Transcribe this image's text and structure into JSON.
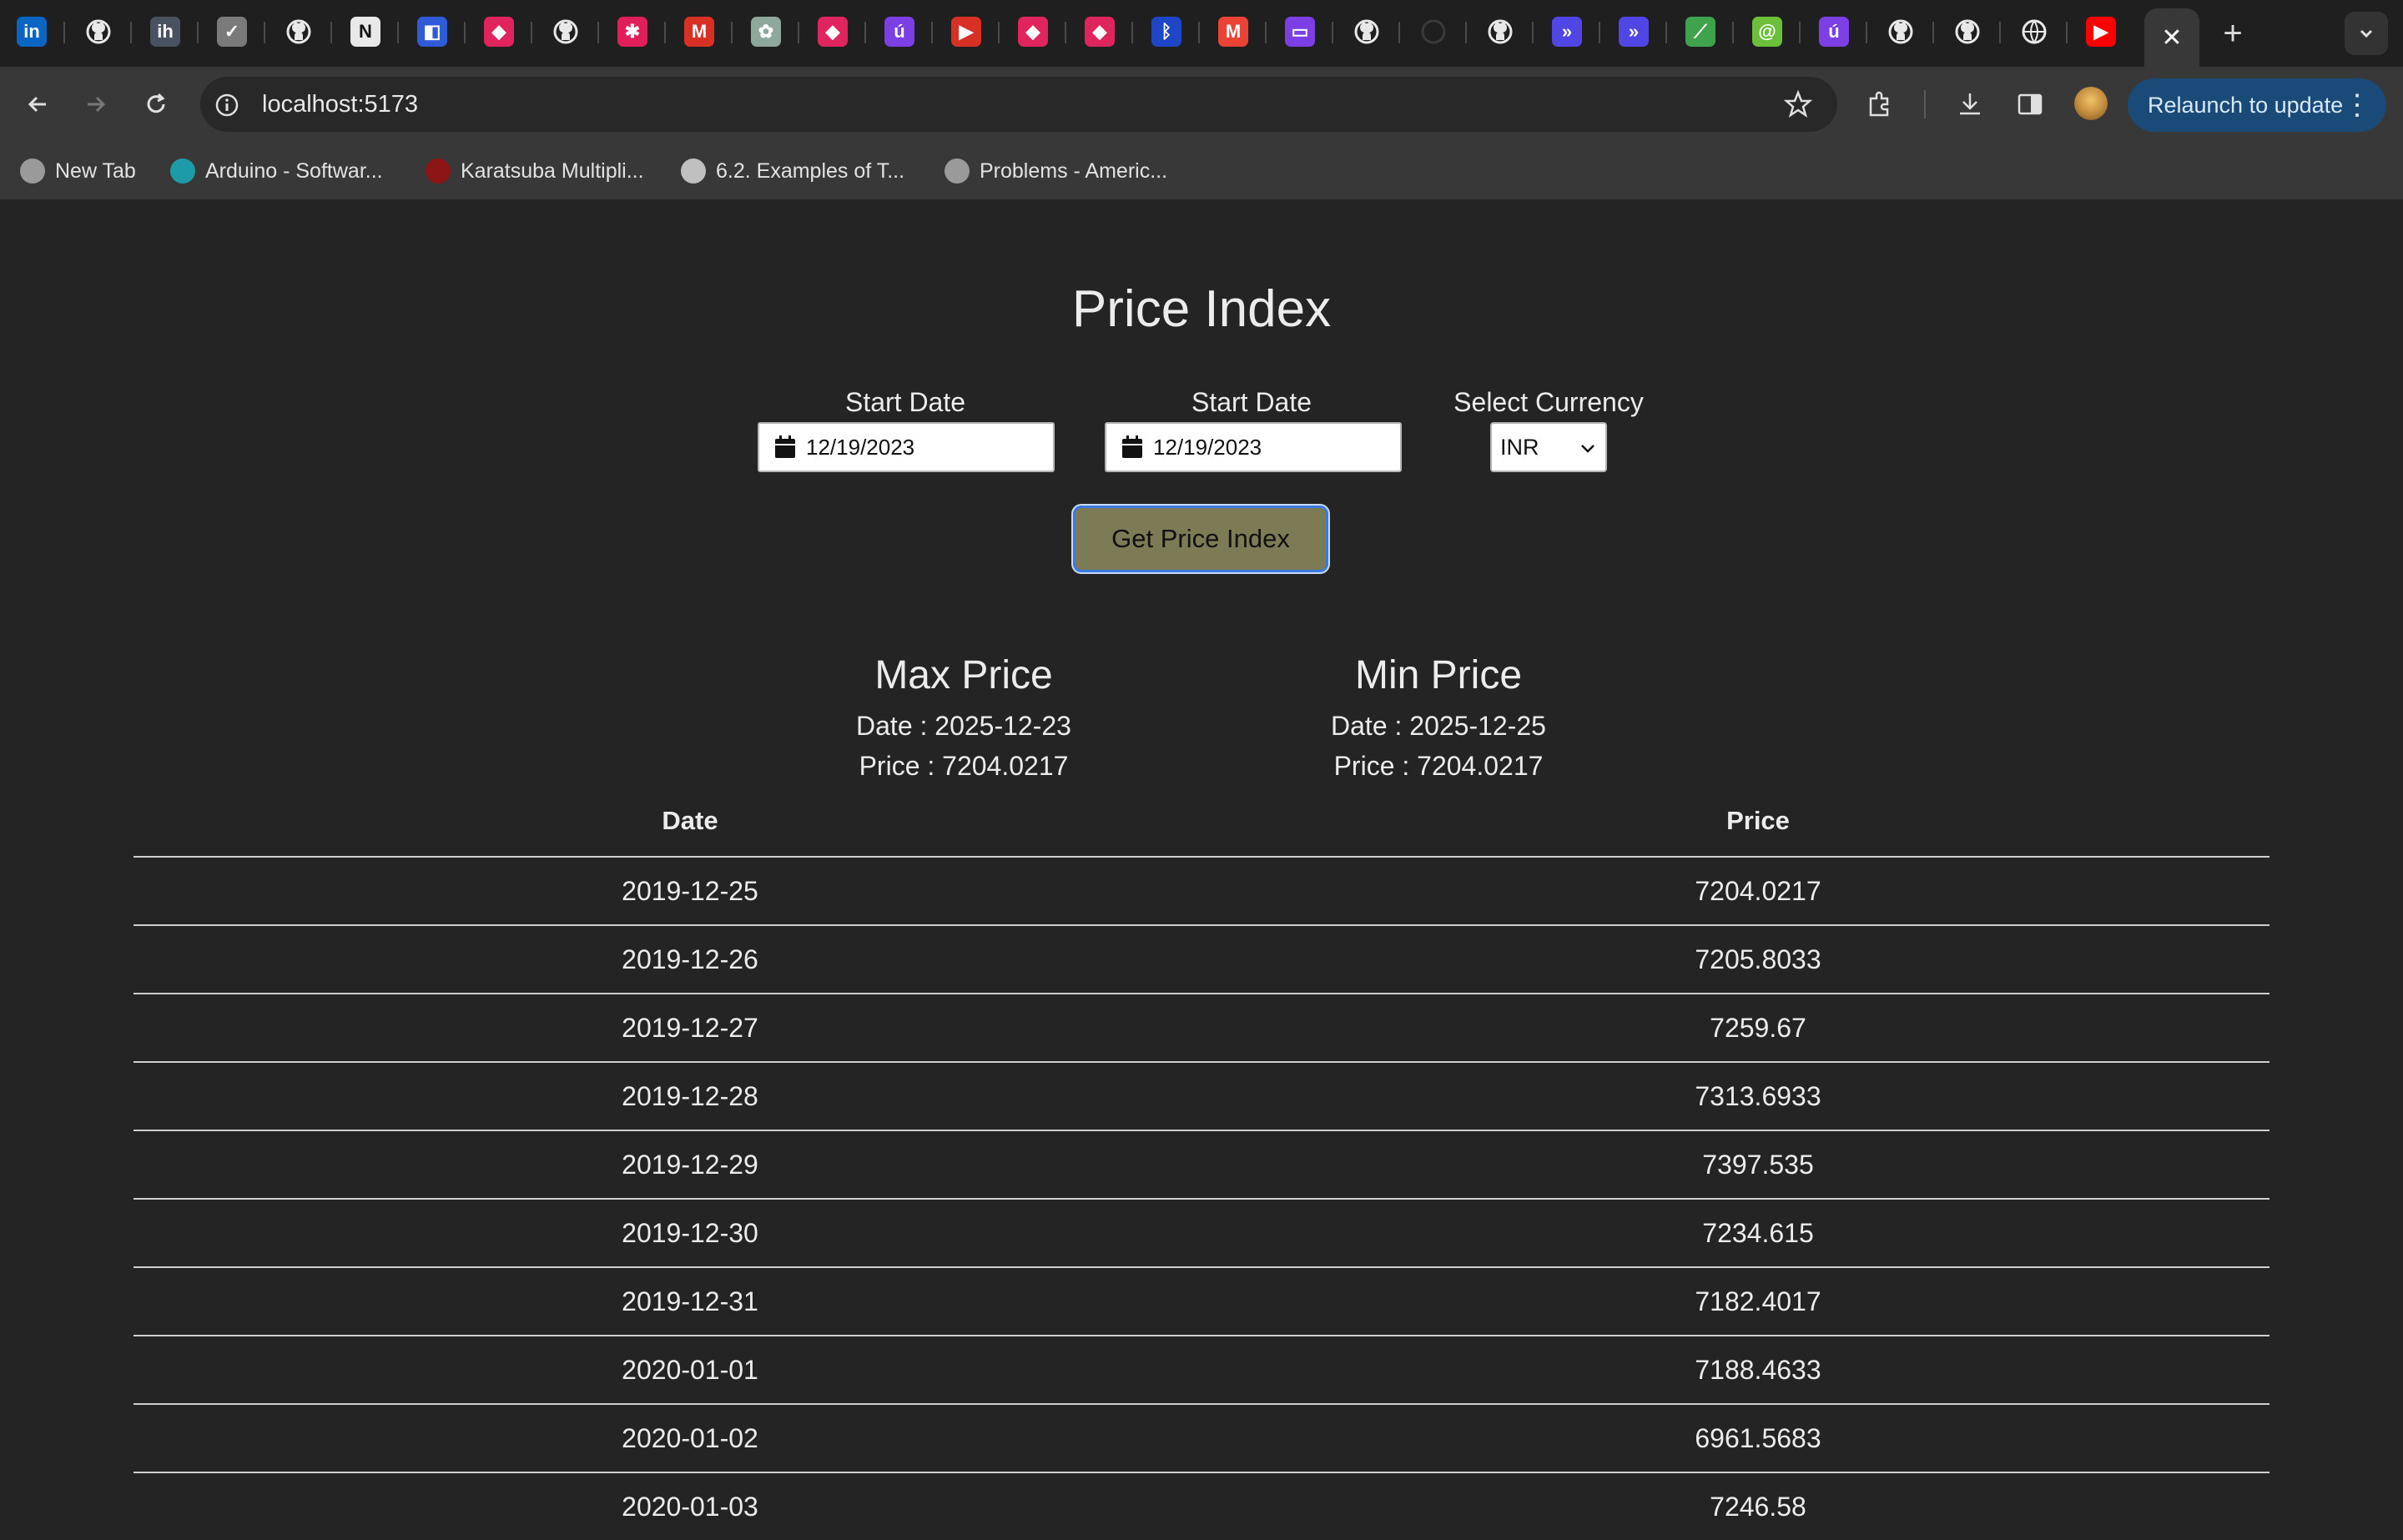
{
  "browser": {
    "tabs": [
      {
        "icon": "linkedin-icon",
        "glyph": "in",
        "color": "#0a66c2"
      },
      {
        "icon": "github-icon",
        "glyph": "",
        "color": "#1f1f1f"
      },
      {
        "icon": "ih-icon",
        "glyph": "ih",
        "color": "#4a5261"
      },
      {
        "icon": "checkmark-icon",
        "glyph": "✓",
        "color": "#7a7a7a"
      },
      {
        "icon": "github-icon",
        "glyph": "",
        "color": "#1f1f1f"
      },
      {
        "icon": "notion-icon",
        "glyph": "N",
        "color": "#e8e8e8"
      },
      {
        "icon": "blue-squares-icon",
        "glyph": "◧",
        "color": "#2f5bd6"
      },
      {
        "icon": "pink-cube-icon",
        "glyph": "◆",
        "color": "#e0245e"
      },
      {
        "icon": "github-icon",
        "glyph": "",
        "color": "#1f1f1f"
      },
      {
        "icon": "slack-icon",
        "glyph": "✱",
        "color": "#e01e5a"
      },
      {
        "icon": "m-logo-icon",
        "glyph": "M",
        "color": "#d93025"
      },
      {
        "icon": "chatgpt-icon",
        "glyph": "✿",
        "color": "#8fa89c"
      },
      {
        "icon": "pink-cube-icon",
        "glyph": "◆",
        "color": "#e0245e"
      },
      {
        "icon": "u-logo-icon",
        "glyph": "ú",
        "color": "#7b3fe4"
      },
      {
        "icon": "flag-icon",
        "glyph": "▶",
        "color": "#d93025"
      },
      {
        "icon": "pink-cube-icon",
        "glyph": "◆",
        "color": "#e0245e"
      },
      {
        "icon": "pink-cube-icon",
        "glyph": "◆",
        "color": "#e0245e"
      },
      {
        "icon": "bluetooth-icon",
        "glyph": "ᛒ",
        "color": "#2046c8"
      },
      {
        "icon": "gmail-icon",
        "glyph": "M",
        "color": "#ea4335"
      },
      {
        "icon": "monitor-icon",
        "glyph": "▭",
        "color": "#7b3fe4"
      },
      {
        "icon": "github-icon",
        "glyph": "",
        "color": "#1f1f1f"
      },
      {
        "icon": "loading-icon",
        "glyph": "",
        "color": "#1f1f1f"
      },
      {
        "icon": "github-icon",
        "glyph": "",
        "color": "#1f1f1f"
      },
      {
        "icon": "chevrons-icon",
        "glyph": "»",
        "color": "#5046e5"
      },
      {
        "icon": "chevrons-icon",
        "glyph": "»",
        "color": "#5046e5"
      },
      {
        "icon": "leaf-icon",
        "glyph": "⟋",
        "color": "#3fa34d"
      },
      {
        "icon": "green-circle-icon",
        "glyph": "@",
        "color": "#6bbf3a"
      },
      {
        "icon": "u-logo-icon",
        "glyph": "ú",
        "color": "#7b3fe4"
      },
      {
        "icon": "github-icon",
        "glyph": "",
        "color": "#1f1f1f"
      },
      {
        "icon": "github-icon",
        "glyph": "",
        "color": "#1f1f1f"
      },
      {
        "icon": "globe-icon",
        "glyph": "",
        "color": "#1f1f1f"
      },
      {
        "icon": "youtube-icon",
        "glyph": "▶",
        "color": "#ff0000"
      }
    ],
    "active_tab_close": "✕",
    "new_tab": "+",
    "url": "localhost:5173",
    "relaunch_label": "Relaunch to update",
    "bookmarks": [
      {
        "label": "New Tab",
        "icon": "globe-icon"
      },
      {
        "label": "Arduino - Softwar...",
        "icon": "arduino-icon"
      },
      {
        "label": "Karatsuba Multipli...",
        "icon": "stanford-icon"
      },
      {
        "label": "6.2. Examples of T...",
        "icon": "doc-icon"
      },
      {
        "label": "Problems - Americ...",
        "icon": "globe-icon"
      }
    ]
  },
  "page": {
    "title": "Price Index",
    "start_label": "Start Date",
    "start_value": "12/19/2023",
    "end_label": "Start Date",
    "end_value": "12/19/2023",
    "currency_label": "Select Currency",
    "currency_value": "INR",
    "submit_label": "Get Price Index",
    "max": {
      "heading": "Max Price",
      "date_line": "Date : 2025-12-23",
      "price_line": "Price : 7204.0217"
    },
    "min": {
      "heading": "Min Price",
      "date_line": "Date : 2025-12-25",
      "price_line": "Price : 7204.0217"
    },
    "table": {
      "headers": [
        "Date",
        "Price"
      ],
      "rows": [
        {
          "date": "2019-12-25",
          "price": "7204.0217"
        },
        {
          "date": "2019-12-26",
          "price": "7205.8033"
        },
        {
          "date": "2019-12-27",
          "price": "7259.67"
        },
        {
          "date": "2019-12-28",
          "price": "7313.6933"
        },
        {
          "date": "2019-12-29",
          "price": "7397.535"
        },
        {
          "date": "2019-12-30",
          "price": "7234.615"
        },
        {
          "date": "2019-12-31",
          "price": "7182.4017"
        },
        {
          "date": "2020-01-01",
          "price": "7188.4633"
        },
        {
          "date": "2020-01-02",
          "price": "6961.5683"
        },
        {
          "date": "2020-01-03",
          "price": "7246.58"
        }
      ]
    }
  }
}
